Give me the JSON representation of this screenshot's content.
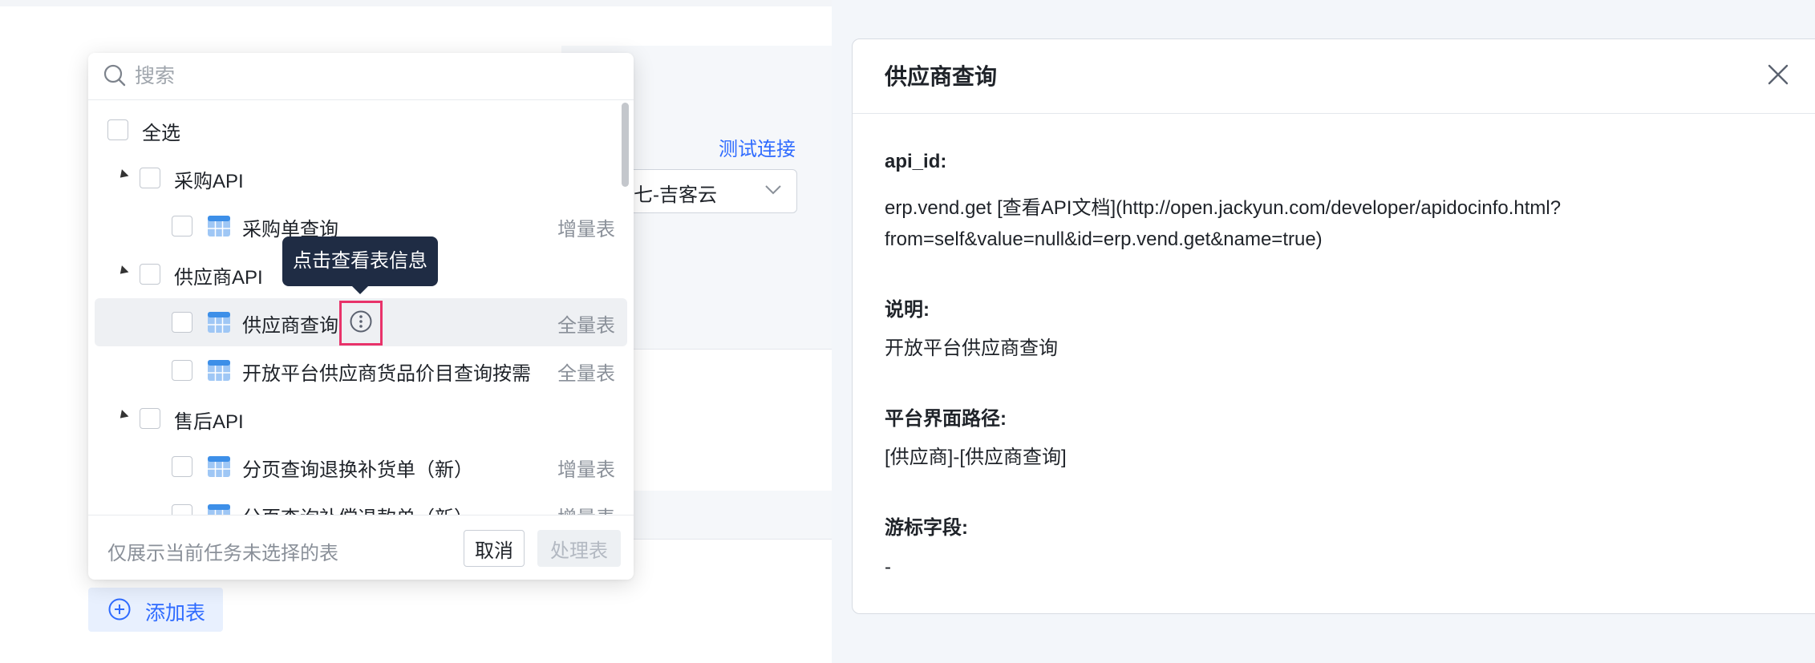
{
  "search": {
    "placeholder": "搜索"
  },
  "tree": {
    "select_all": "全选",
    "groups": [
      {
        "label": "采购API",
        "items": [
          {
            "label": "采购单查询",
            "tag": "增量表"
          }
        ]
      },
      {
        "label": "供应商API",
        "items": [
          {
            "label": "供应商查询",
            "tag": "全量表"
          },
          {
            "label": "开放平台供应商货品价目查询按需",
            "tag": "全量表"
          }
        ]
      },
      {
        "label": "售后API",
        "items": [
          {
            "label": "分页查询退换补货单（新）",
            "tag": "增量表"
          },
          {
            "label": "分页查询补偿退款单（新）",
            "tag": "增量表"
          }
        ]
      }
    ]
  },
  "tooltip": "点击查看表信息",
  "footer": {
    "hint": "仅展示当前任务未选择的表",
    "cancel": "取消",
    "process": "处理表"
  },
  "background_form": {
    "test_link": "测试连接",
    "select_value": "七-吉客云",
    "add_table": "添加表"
  },
  "detail": {
    "title": "供应商查询",
    "sections": [
      {
        "label": "api_id:",
        "lines": [
          "erp.vend.get [查看API文档](http://open.jackyun.com/developer/apidocinfo.html?",
          "from=self&value=null&id=erp.vend.get&name=true)"
        ]
      },
      {
        "label": "说明:",
        "lines": [
          "开放平台供应商查询"
        ]
      },
      {
        "label": "平台界面路径:",
        "lines": [
          "[供应商]-[供应商查询]"
        ]
      },
      {
        "label": "游标字段:",
        "lines": [
          "-"
        ]
      }
    ]
  },
  "colors": {
    "accent": "#2f6bff",
    "tooltip_bg": "#1f2c44",
    "highlight_box": "#e8336a"
  }
}
